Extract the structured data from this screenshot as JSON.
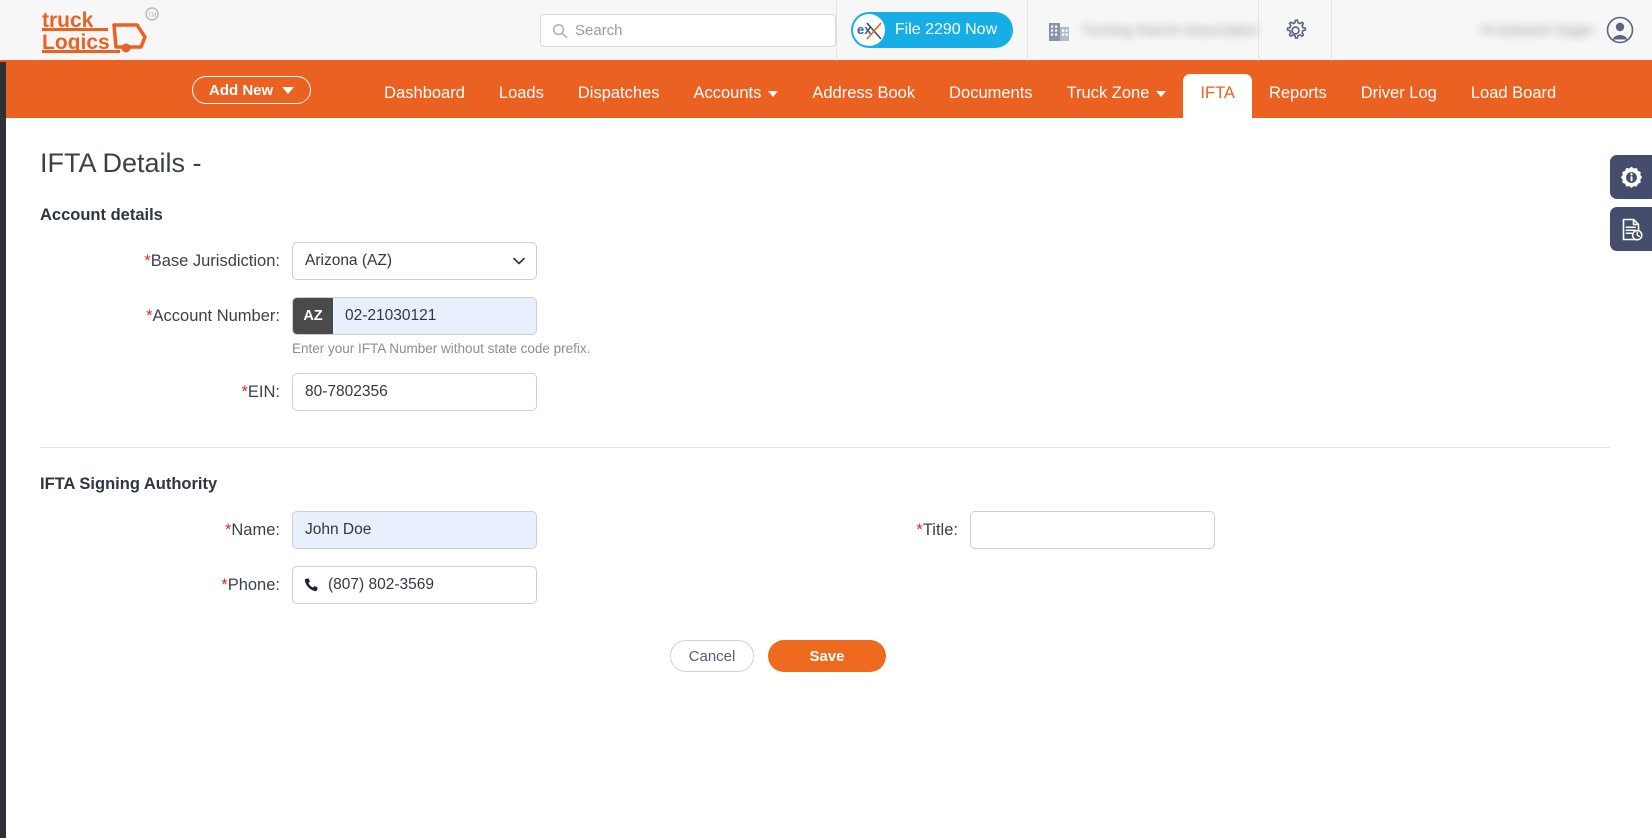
{
  "brand": {
    "logo_text_line1": "truck",
    "logo_text_line2": "Logics",
    "trademark": "®",
    "orange": "#eb6122",
    "blue": "#16aee4",
    "navy": "#444e6c"
  },
  "header": {
    "search": {
      "placeholder": "Search",
      "value": "",
      "icon": "search-icon"
    },
    "file_2290_button": {
      "label": "File 2290 Now",
      "badge": "EX"
    },
    "company_name": "Turning Ranch Association",
    "user_name": "Hi Edward Sager",
    "gear_icon": "gear-icon",
    "building_icon": "building-icon",
    "avatar_icon": "avatar-icon"
  },
  "nav": {
    "add_new": "Add New",
    "items": [
      {
        "label": "Dashboard",
        "has_caret": false,
        "active": false
      },
      {
        "label": "Loads",
        "has_caret": false,
        "active": false
      },
      {
        "label": "Dispatches",
        "has_caret": false,
        "active": false
      },
      {
        "label": "Accounts",
        "has_caret": true,
        "active": false
      },
      {
        "label": "Address Book",
        "has_caret": false,
        "active": false
      },
      {
        "label": "Documents",
        "has_caret": false,
        "active": false
      },
      {
        "label": "Truck Zone",
        "has_caret": true,
        "active": false
      },
      {
        "label": "IFTA",
        "has_caret": false,
        "active": true
      },
      {
        "label": "Reports",
        "has_caret": false,
        "active": false
      },
      {
        "label": "Driver Log",
        "has_caret": false,
        "active": false
      },
      {
        "label": "Load Board",
        "has_caret": false,
        "active": false
      }
    ]
  },
  "page": {
    "title": "IFTA Details -",
    "account_section": {
      "heading": "Account details",
      "base_jurisdiction": {
        "label": "Base Jurisdiction:",
        "required": "*",
        "value": "Arizona (AZ)"
      },
      "account_number": {
        "label": "Account Number:",
        "required": "*",
        "prefix": "AZ",
        "value": "02-21030121",
        "hint": "Enter your IFTA Number without state code prefix."
      },
      "ein": {
        "label": "EIN:",
        "required": "*",
        "value": "80-7802356"
      }
    },
    "signing_section": {
      "heading": "IFTA Signing Authority",
      "name": {
        "label": "Name:",
        "required": "*",
        "value": "John Doe"
      },
      "phone": {
        "label": "Phone:",
        "required": "*",
        "value": "(807) 802-3569",
        "icon": "phone-icon"
      },
      "title": {
        "label": "Title:",
        "required": "*",
        "value": "",
        "placeholder": ""
      }
    },
    "buttons": {
      "cancel": "Cancel",
      "save": "Save"
    }
  },
  "side_tools": [
    {
      "name": "info-gear-icon"
    },
    {
      "name": "document-history-icon"
    }
  ]
}
